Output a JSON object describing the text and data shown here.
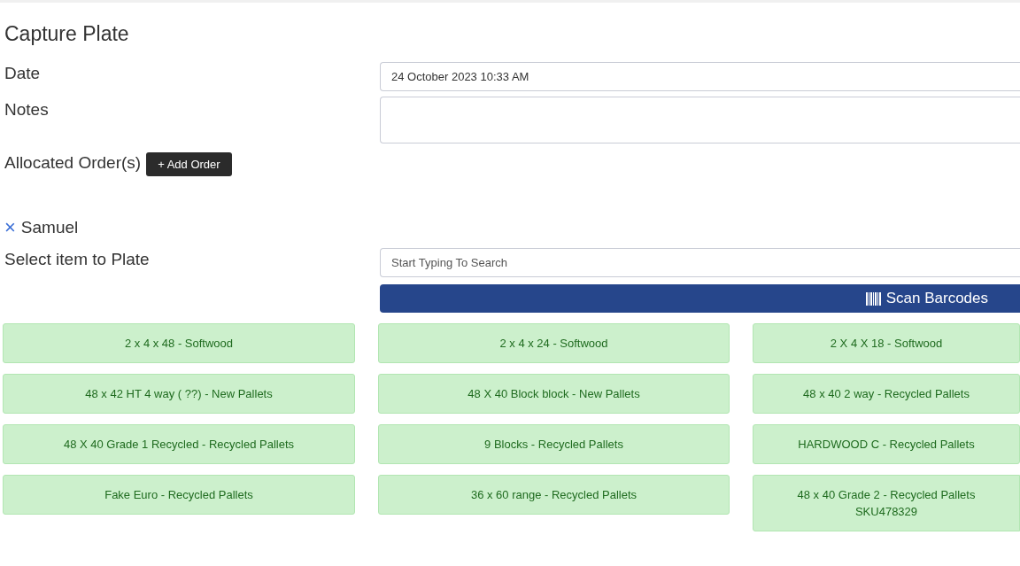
{
  "title": "Capture Plate",
  "date": {
    "label": "Date",
    "value": "24 October 2023 10:33 AM"
  },
  "notes": {
    "label": "Notes"
  },
  "orders": {
    "label": "Allocated Order(s)",
    "add_button": "+ Add Order",
    "allocated": [
      {
        "remove": "×",
        "name": "Samuel"
      }
    ]
  },
  "select": {
    "label": "Select item to Plate",
    "placeholder": "Start Typing To Search",
    "scan_button": "Scan Barcodes"
  },
  "items": [
    {
      "name": "2 x 4 x 48 - Softwood"
    },
    {
      "name": "2 x 4 x 24 - Softwood"
    },
    {
      "name": "2 X 4 X 18 - Softwood"
    },
    {
      "name": "48 x 42 HT 4 way ( ??) - New Pallets"
    },
    {
      "name": "48 X 40 Block block - New Pallets"
    },
    {
      "name": "48 x 40 2 way - Recycled Pallets"
    },
    {
      "name": "48 X 40 Grade 1 Recycled - Recycled Pallets"
    },
    {
      "name": "9 Blocks - Recycled Pallets"
    },
    {
      "name": "HARDWOOD C - Recycled Pallets"
    },
    {
      "name": "Fake Euro - Recycled Pallets"
    },
    {
      "name": "36 x 60 range - Recycled Pallets"
    },
    {
      "name": "48 x 40 Grade 2 - Recycled Pallets",
      "sku": "SKU478329"
    }
  ]
}
